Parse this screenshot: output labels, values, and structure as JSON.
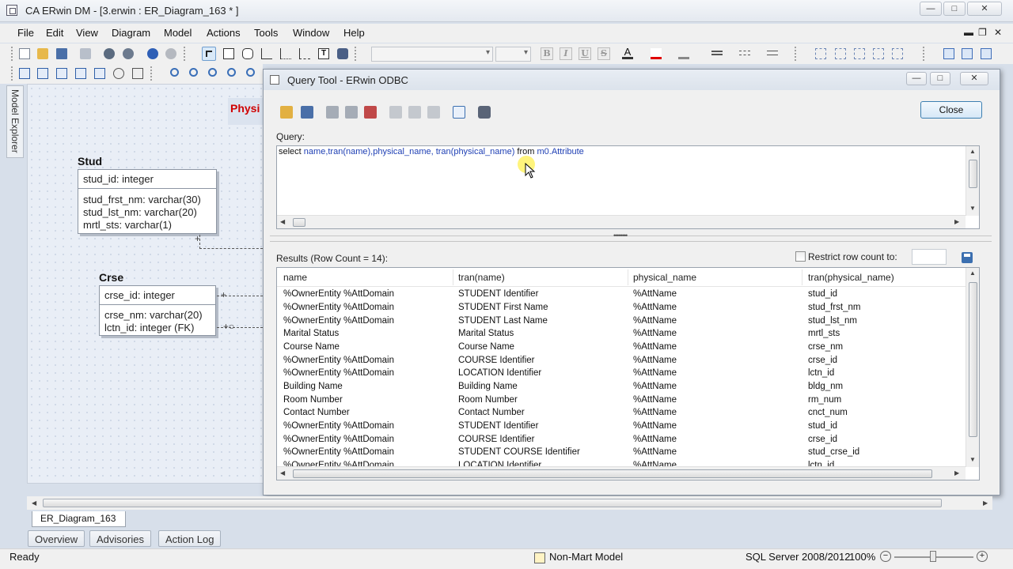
{
  "window": {
    "title": "CA ERwin DM - [3.erwin : ER_Diagram_163 * ]",
    "min": "—",
    "max": "□",
    "close": "✕"
  },
  "menu": [
    "File",
    "Edit",
    "View",
    "Diagram",
    "Model",
    "Actions",
    "Tools",
    "Window",
    "Help"
  ],
  "format_toolbar": {
    "bold": "B",
    "italic": "I",
    "underline": "U",
    "strike": "S"
  },
  "explorer": {
    "label": "Model Explorer"
  },
  "canvas": {
    "banner": "Physi"
  },
  "entities": [
    {
      "name": "Stud",
      "pk": "stud_id: integer",
      "attrs": [
        "stud_frst_nm: varchar(30)",
        "stud_lst_nm: varchar(20)",
        "mrtl_sts: varchar(1)"
      ]
    },
    {
      "name": "Crse",
      "pk": "crse_id: integer",
      "attrs": [
        "crse_nm: varchar(20)",
        "lctn_id: integer (FK)"
      ]
    }
  ],
  "query_tool": {
    "title": "Query Tool - ERwin ODBC",
    "close_button": "Close",
    "query_label": "Query:",
    "query_parts": [
      {
        "text": "select ",
        "kind": "kw"
      },
      {
        "text": "name,tran(name),physical_name, tran(physical_name)",
        "kind": "id"
      },
      {
        "text": " from ",
        "kind": "kw"
      },
      {
        "text": "m0.Attribute",
        "kind": "id"
      }
    ],
    "results_label": "Results (Row Count = 14):",
    "restrict_label": "Restrict row count to:",
    "restrict_value": "",
    "columns": [
      "name",
      "tran(name)",
      "physical_name",
      "tran(physical_name)"
    ],
    "rows": [
      [
        "%OwnerEntity %AttDomain",
        "STUDENT Identifier",
        "%AttName",
        "stud_id"
      ],
      [
        "%OwnerEntity %AttDomain",
        "STUDENT First Name",
        "%AttName",
        "stud_frst_nm"
      ],
      [
        "%OwnerEntity %AttDomain",
        "STUDENT Last Name",
        "%AttName",
        "stud_lst_nm"
      ],
      [
        "Marital Status",
        "Marital Status",
        "%AttName",
        "mrtl_sts"
      ],
      [
        "Course Name",
        "Course Name",
        "%AttName",
        "crse_nm"
      ],
      [
        "%OwnerEntity %AttDomain",
        "COURSE Identifier",
        "%AttName",
        "crse_id"
      ],
      [
        "%OwnerEntity %AttDomain",
        "LOCATION Identifier",
        "%AttName",
        "lctn_id"
      ],
      [
        "Building Name",
        "Building Name",
        "%AttName",
        "bldg_nm"
      ],
      [
        "Room Number",
        "Room Number",
        "%AttName",
        "rm_num"
      ],
      [
        "Contact Number",
        "Contact Number",
        "%AttName",
        "cnct_num"
      ],
      [
        "%OwnerEntity %AttDomain",
        "STUDENT Identifier",
        "%AttName",
        "stud_id"
      ],
      [
        "%OwnerEntity %AttDomain",
        "COURSE Identifier",
        "%AttName",
        "crse_id"
      ],
      [
        "%OwnerEntity %AttDomain",
        "STUDENT COURSE Identifier",
        "%AttName",
        "stud_crse_id"
      ],
      [
        "%OwnerEntity %AttDomain",
        "LOCATION Identifier",
        "%AttName",
        "lctn_id"
      ]
    ]
  },
  "tabs": {
    "diagram": "ER_Diagram_163",
    "bottom": [
      "Overview",
      "Advisories",
      "Action Log"
    ]
  },
  "status": {
    "ready": "Ready",
    "mart": "Non-Mart Model",
    "db": "SQL Server 2008/2012",
    "zoom": "100%"
  },
  "colors": {
    "accent": "#1e3fb4",
    "banner_text": "#d00000"
  }
}
